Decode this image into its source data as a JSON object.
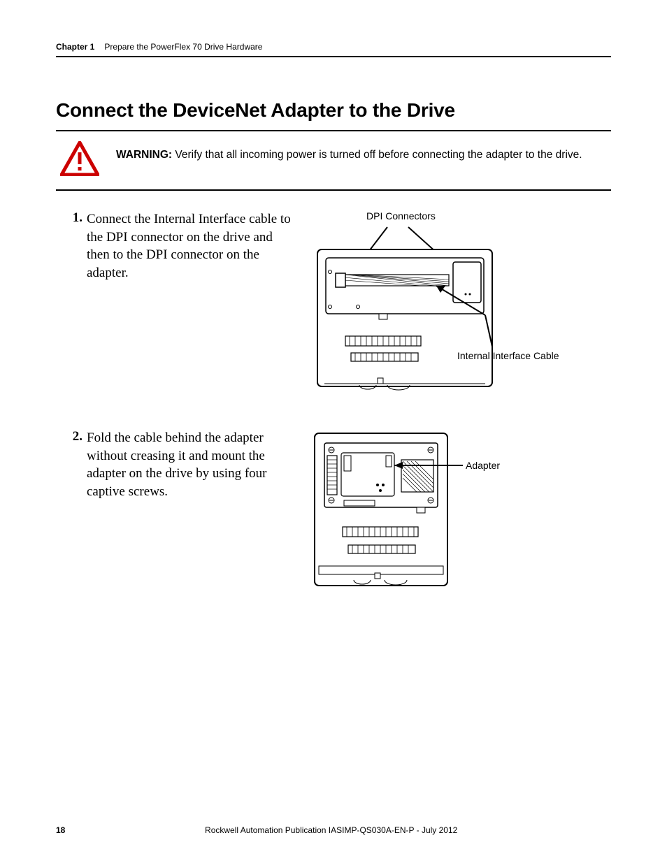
{
  "header": {
    "chapter": "Chapter 1",
    "title": "Prepare the PowerFlex 70 Drive Hardware"
  },
  "section_title": "Connect the DeviceNet Adapter to the Drive",
  "warning": {
    "label": "WARNING:",
    "text": "Verify that all incoming power is turned off before connecting the adapter to the drive."
  },
  "steps": [
    {
      "num": "1.",
      "text": "Connect the Internal Interface cable to the DPI connector on the drive and then to the DPI connector on the adapter.",
      "labels": {
        "top": "DPI Connectors",
        "right": "Internal Interface Cable"
      }
    },
    {
      "num": "2.",
      "text": "Fold the cable behind the adapter without creasing it and mount the adapter on the drive by using four captive screws.",
      "labels": {
        "right": "Adapter"
      }
    }
  ],
  "footer": {
    "page": "18",
    "publication": "Rockwell Automation Publication IASIMP-QS030A-EN-P - July 2012"
  }
}
